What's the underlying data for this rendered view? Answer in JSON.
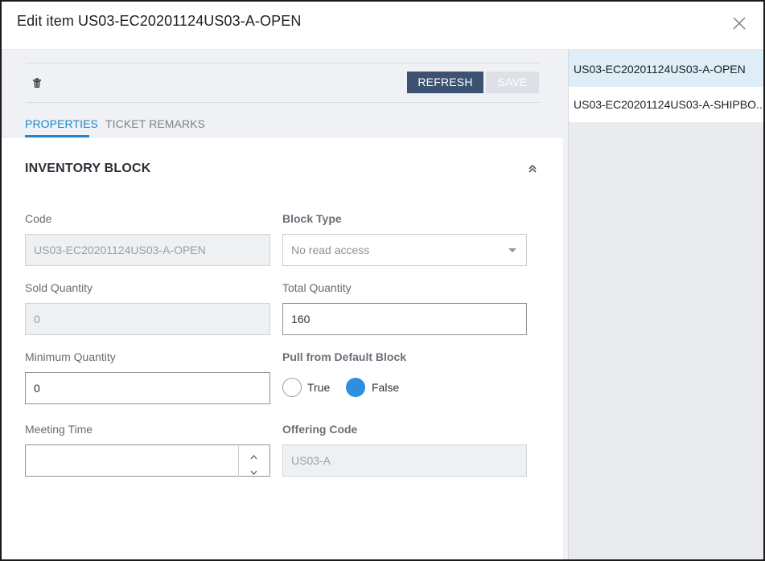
{
  "dialog": {
    "title": "Edit item US03-EC20201124US03-A-OPEN",
    "close_icon": "close-icon"
  },
  "toolbar": {
    "delete_icon": "trash-icon",
    "refresh_label": "REFRESH",
    "save_label": "SAVE"
  },
  "tabs": [
    {
      "label": "PROPERTIES",
      "active": true
    },
    {
      "label": "TICKET REMARKS",
      "active": false
    }
  ],
  "section": {
    "title": "INVENTORY BLOCK",
    "collapse_icon": "chevron-double-up-icon"
  },
  "form": {
    "code": {
      "label": "Code",
      "value": "US03-EC20201124US03-A-OPEN"
    },
    "block_type": {
      "label": "Block Type",
      "value": "No read access"
    },
    "sold_quantity": {
      "label": "Sold Quantity",
      "value": "0"
    },
    "total_quantity": {
      "label": "Total Quantity",
      "value": "160"
    },
    "minimum_quantity": {
      "label": "Minimum Quantity",
      "value": "0"
    },
    "pull_default": {
      "label": "Pull from Default Block",
      "options": [
        "True",
        "False"
      ],
      "selected": "False"
    },
    "meeting_time": {
      "label": "Meeting Time",
      "value": ""
    },
    "offering_code": {
      "label": "Offering Code",
      "value": "US03-A"
    }
  },
  "sidebar": {
    "items": [
      {
        "label": "US03-EC20201124US03-A-OPEN",
        "active": true
      },
      {
        "label": "US03-EC20201124US03-A-SHIPBO...",
        "active": false
      }
    ]
  },
  "colors": {
    "accent": "#1c86d1",
    "refresh_button": "#3b5272",
    "radio_selected": "#2e8fe0",
    "sidebar_active": "#ddeef9"
  }
}
